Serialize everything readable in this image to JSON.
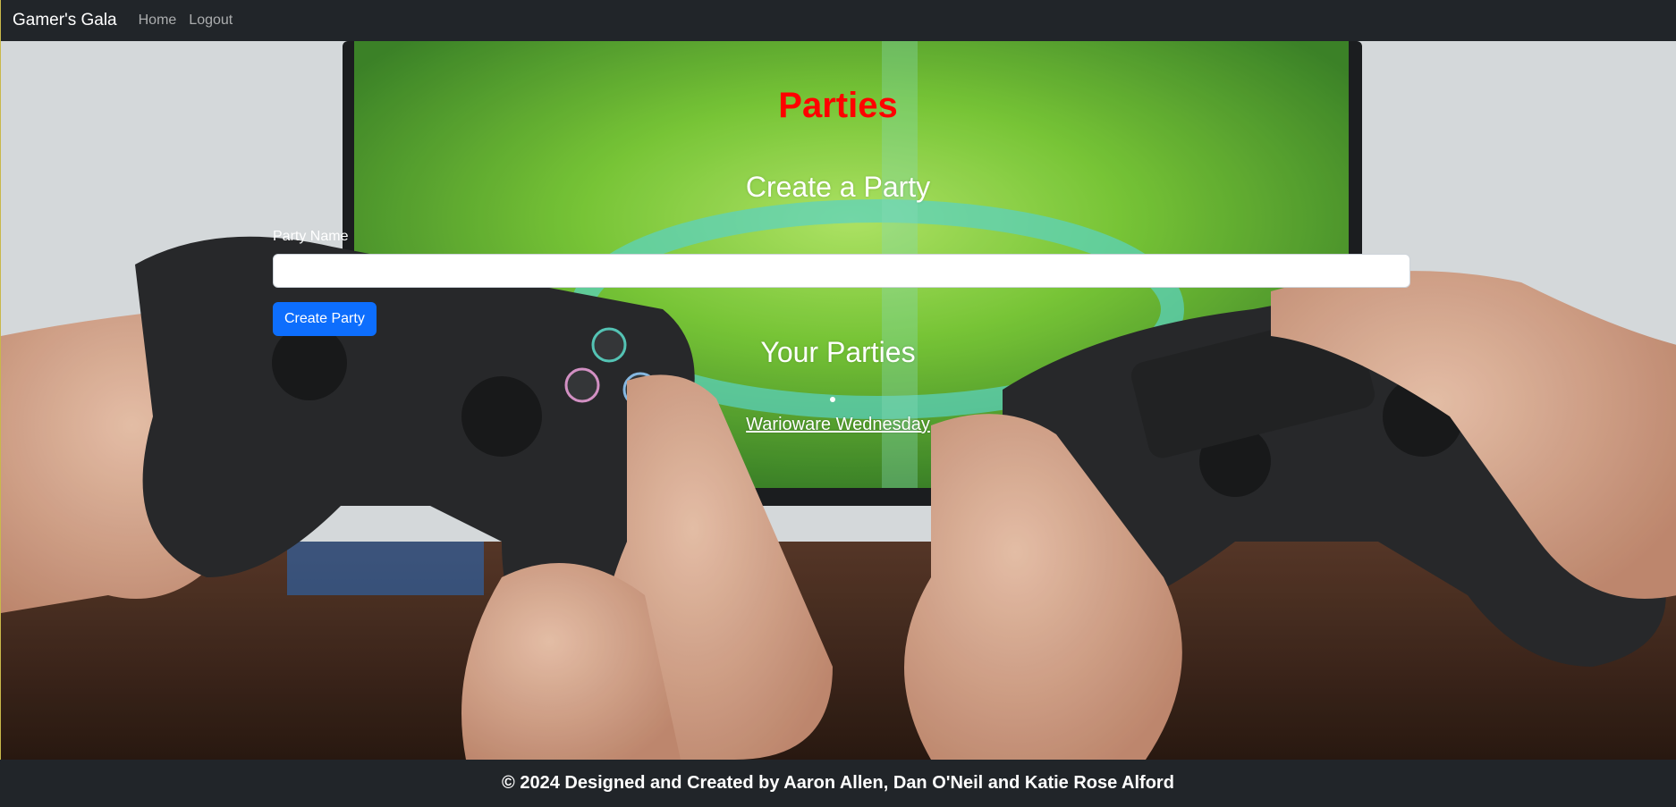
{
  "navbar": {
    "brand": "Gamer's Gala",
    "links": [
      "Home",
      "Logout"
    ]
  },
  "page": {
    "title": "Parties",
    "create_heading": "Create a Party",
    "party_name_label": "Party Name",
    "party_name_value": "",
    "party_name_placeholder": "",
    "create_button": "Create Party",
    "your_heading": "Your Parties",
    "parties": [
      "Warioware Wednesday"
    ]
  },
  "footer": {
    "text": "© 2024 Designed and Created by Aaron Allen, Dan O'Neil and Katie Rose Alford"
  },
  "colors": {
    "navbar_bg": "#212529",
    "title_red": "#ff0000",
    "button_blue": "#0d6efd"
  }
}
